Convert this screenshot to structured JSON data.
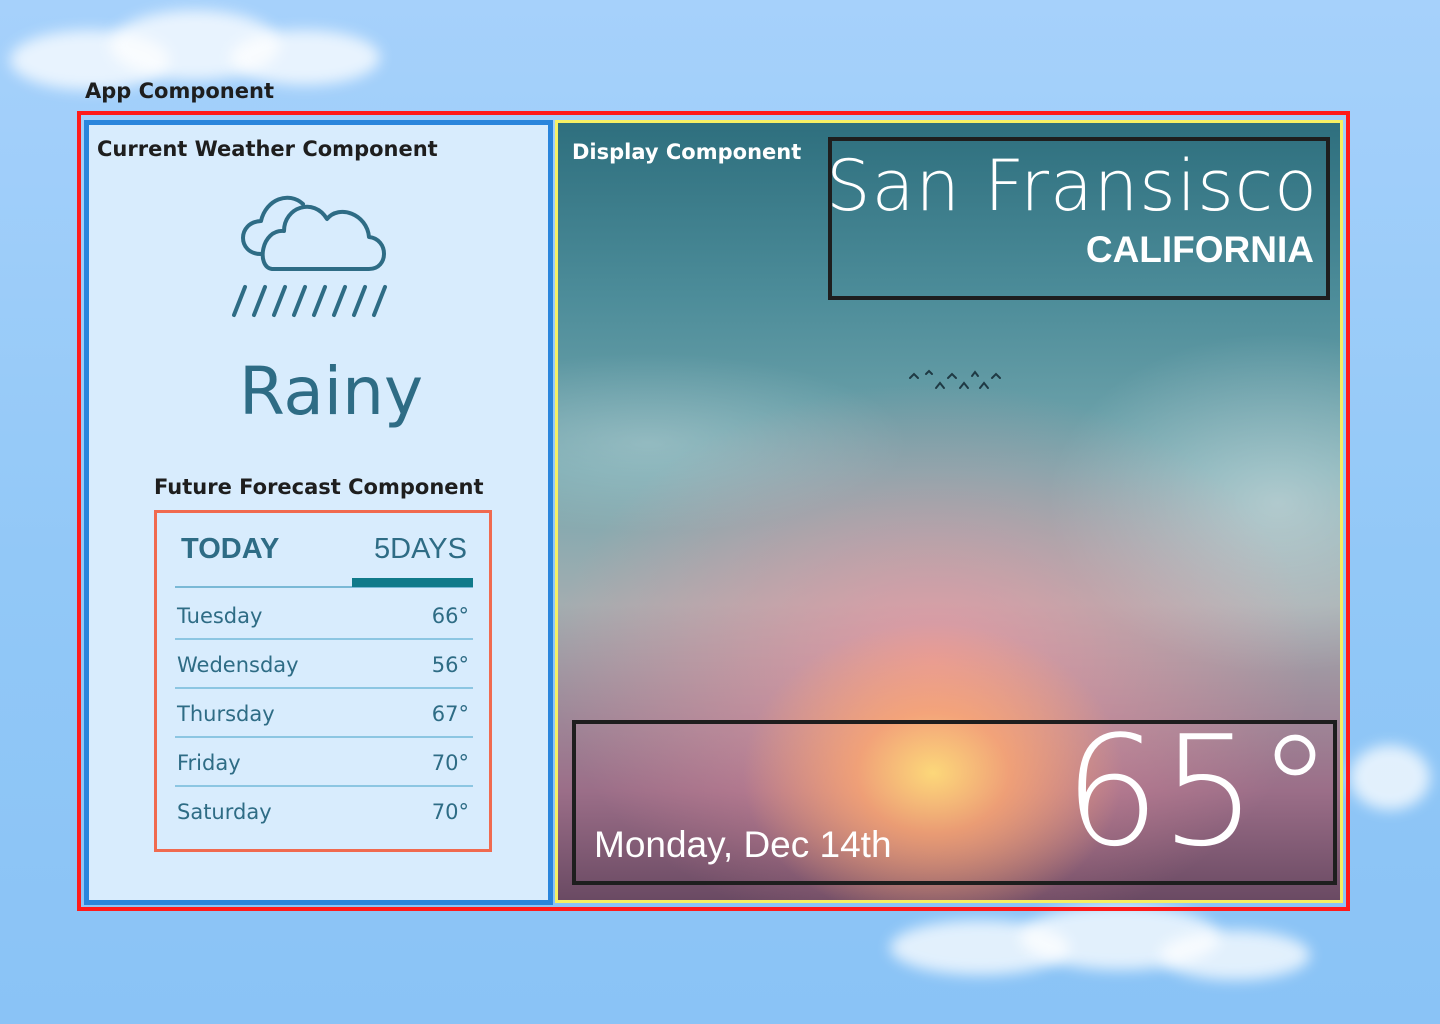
{
  "labels": {
    "app": "App Component",
    "current_weather": "Current Weather Component",
    "future_forecast": "Future Forecast Component",
    "display": "Display Component"
  },
  "current_weather": {
    "icon": "rain-cloud-icon",
    "condition": "Rainy"
  },
  "forecast": {
    "tabs": [
      {
        "label": "TODAY",
        "active": false
      },
      {
        "label": "5DAYS",
        "active": true
      }
    ],
    "days": [
      {
        "day": "Tuesday",
        "temp": "66°"
      },
      {
        "day": "Wedensday",
        "temp": "56°"
      },
      {
        "day": "Thursday",
        "temp": "67°"
      },
      {
        "day": "Friday",
        "temp": "70°"
      },
      {
        "day": "Saturday",
        "temp": "70°"
      }
    ]
  },
  "display": {
    "city": "San Fransisco",
    "state": "CALIFORNIA",
    "date": "Monday, Dec 14th",
    "temperature": "65°"
  },
  "colors": {
    "app_border": "#ff1a1a",
    "current_border": "#2a85dc",
    "display_border": "#f6f064",
    "forecast_border": "#f06a4f",
    "accent": "#2e6c85",
    "tab_indicator": "#107a8a"
  }
}
